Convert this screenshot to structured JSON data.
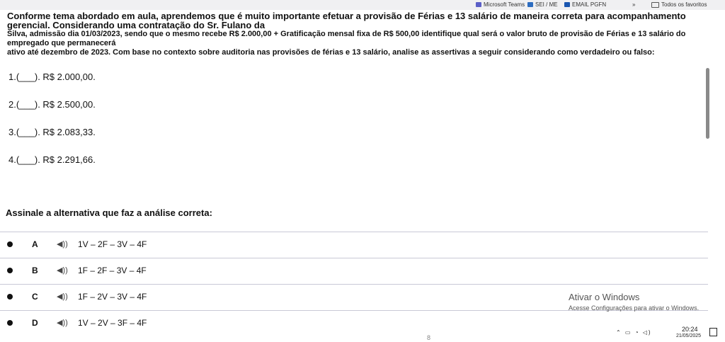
{
  "bookmarks": [
    {
      "label": "Microsoft Teams",
      "icon": "teams-icon"
    },
    {
      "label": "SEI / ME",
      "icon": "sei-icon"
    },
    {
      "label": "EMAIL PGFN",
      "icon": "email-icon"
    }
  ],
  "bookmarks_overflow": "»",
  "all_bookmarks": "Todos os favoritos",
  "intro": {
    "lead": "Conforme tema abordado em aula, aprendemos que é muito importante efetuar a provisão de Férias e 13 salário de maneira correta para acompanhamento gerencial. Considerando uma contratação do Sr. Fulano da",
    "line2": "Silva, admissão dia 01/03/2023, sendo que o mesmo recebe R$ 2.000,00 + Gratificação mensal fixa de R$ 500,00 identifique qual será o valor bruto de provisão de Férias e 13 salário do empregado que permanecerá",
    "line3": "ativo até dezembro de 2023. Com base no contexto sobre auditoria nas provisões de férias e 13 salário, analise as assertivas a seguir considerando como verdadeiro ou falso:"
  },
  "statements": [
    "1.(___). R$ 2.000,00.",
    "2.(___). R$ 2.500,00.",
    "3.(___). R$ 2.083,33.",
    "4.(___). R$ 2.291,66."
  ],
  "question": "Assinale a alternativa que faz a análise correta:",
  "options": [
    {
      "letter": "A",
      "text": "1V – 2F – 3V – 4F"
    },
    {
      "letter": "B",
      "text": "1F – 2F – 3V – 4F"
    },
    {
      "letter": "C",
      "text": "1F – 2V – 3V – 4F"
    },
    {
      "letter": "D",
      "text": "1V – 2V – 3F – 4F"
    }
  ],
  "speaker_glyph": "◀))",
  "windows_activation": {
    "title": "Ativar o Windows",
    "subtitle": "Acesse Configurações para ativar o Windows."
  },
  "page_number": "8",
  "taskbar": {
    "time": "20:24",
    "date": "21/05/2025"
  },
  "colors": {
    "accent_teams": "#5b5fc7",
    "accent_sei": "#2d6cc0",
    "accent_email": "#1a56b0"
  }
}
